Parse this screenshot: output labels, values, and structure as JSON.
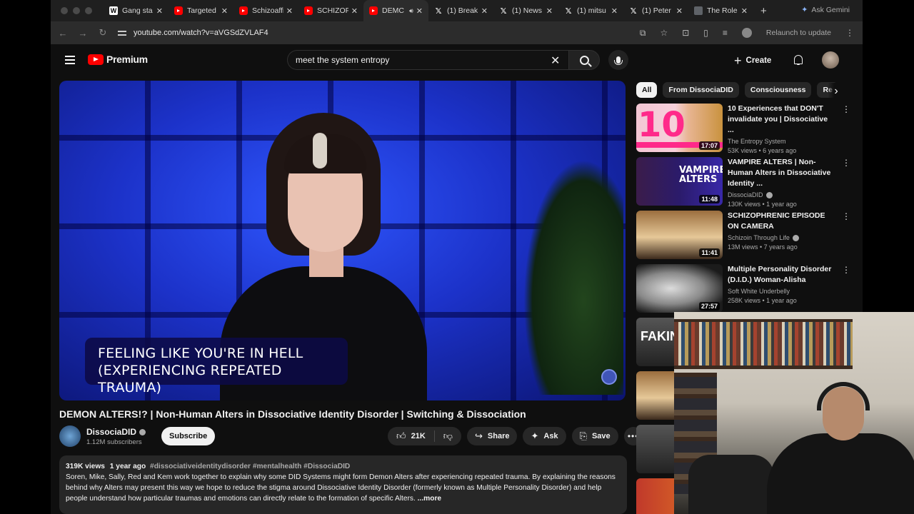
{
  "browser": {
    "tabs": [
      {
        "label": "Gang sta",
        "icon": "w"
      },
      {
        "label": "Targeted",
        "icon": "yt"
      },
      {
        "label": "Schizoaffi",
        "icon": "yt"
      },
      {
        "label": "SCHIZOF",
        "icon": "yt"
      },
      {
        "label": "DEMC",
        "icon": "yt",
        "active": true,
        "audio": true
      },
      {
        "label": "(1) Break",
        "icon": "x"
      },
      {
        "label": "(1) News",
        "icon": "x"
      },
      {
        "label": "(1) mitsu",
        "icon": "x"
      },
      {
        "label": "(1) Peter",
        "icon": "x"
      },
      {
        "label": "The Role",
        "icon": "gl"
      }
    ],
    "ask_gemini": "Ask Gemini",
    "url": "youtube.com/watch?v=aVGSdZVLAF4",
    "relaunch": "Relaunch to update"
  },
  "youtube": {
    "logo_text": "Premium",
    "search_query": "meet the system entropy",
    "create_label": "Create"
  },
  "video": {
    "caption_line1": "FEELING LIKE YOU'RE IN HELL",
    "caption_line2": "(EXPERIENCING REPEATED TRAUMA)",
    "title": "DEMON ALTERS!? | Non-Human Alters in Dissociative Identity Disorder | Switching & Dissociation",
    "channel": "DissociaDID",
    "subscribers": "1.12M subscribers",
    "subscribe_label": "Subscribe",
    "likes": "21K",
    "share_label": "Share",
    "ask_label": "Ask",
    "save_label": "Save",
    "views": "319K views",
    "age": "1 year ago",
    "hashtags": "#dissociativeidentitydisorder #mentalhealth #DissociaDID",
    "description": "Soren, Mike, Sally, Red and Kem work together to explain why some DID Systems might form Demon Alters after experiencing repeated trauma. By explaining the reasons behind why Alters may present this way we hope to reduce the stigma around Dissociative Identity Disorder (formerly known as Multiple Personality Disorder) and help people understand how particular traumas and emotions can directly relate to the formation of specific Alters.",
    "more_label": "...more"
  },
  "chips": [
    "All",
    "From DissociaDID",
    "Consciousness",
    "Re"
  ],
  "recommendations": [
    {
      "title": "10 Experiences that DON'T invalidate you | Dissociative ...",
      "channel": "The Entropy System",
      "verified": false,
      "meta": "53K views • 6 years ago",
      "duration": "17:07",
      "thumb_text": "10"
    },
    {
      "title": "VAMPIRE ALTERS | Non-Human Alters in Dissociative Identity ...",
      "channel": "DissociaDID",
      "verified": true,
      "meta": "130K views • 1 year ago",
      "duration": "11:48",
      "thumb_text": "VAMPIRE ALTERS"
    },
    {
      "title": "SCHIZOPHRENIC EPISODE ON CAMERA",
      "channel": "Schizoin Through Life",
      "verified": true,
      "meta": "13M views • 7 years ago",
      "duration": "11:41"
    },
    {
      "title": "Multiple Personality Disorder (D.I.D.) Woman-Alisha",
      "channel": "Soft White Underbelly",
      "verified": false,
      "meta": "258K views • 1 year ago",
      "duration": "27:57"
    },
    {
      "title": "",
      "channel": "",
      "meta": "",
      "duration": "",
      "thumb_text": "FAKIN"
    }
  ]
}
